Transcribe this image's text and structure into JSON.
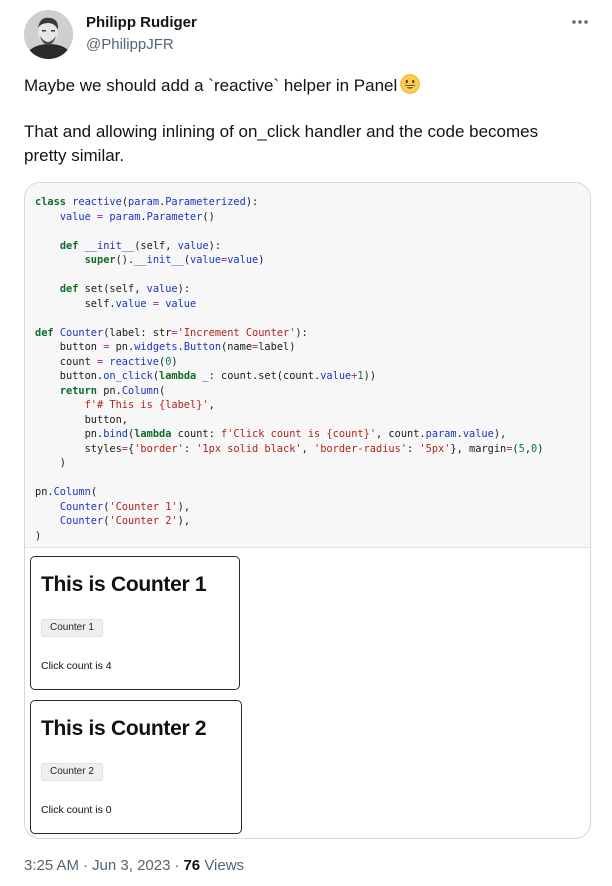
{
  "author": {
    "name": "Philipp Rudiger",
    "handle": "@PhilippJFR"
  },
  "tweet": {
    "line1": "Maybe we should add a `reactive` helper in Panel",
    "line1_emoji": "grinning-face-emoji",
    "line2": "That and allowing inlining of on_click handler and the code becomes pretty similar."
  },
  "media": {
    "code": [
      "class reactive(param.Parameterized):",
      "    value = param.Parameter()",
      "",
      "    def __init__(self, value):",
      "        super().__init__(value=value)",
      "",
      "    def set(self, value):",
      "        self.value = value",
      "",
      "def Counter(label: str='Increment Counter'):",
      "    button = pn.widgets.Button(name=label)",
      "    count = reactive(0)",
      "    button.on_click(lambda _: count.set(count.value+1))",
      "    return pn.Column(",
      "        f'# This is {label}',",
      "        button,",
      "        pn.bind(lambda count: f'Click count is {count}', count.param.value),",
      "        styles={'border': '1px solid black', 'border-radius': '5px'}, margin=(5,0)",
      "    )",
      "",
      "pn.Column(",
      "    Counter('Counter 1'),",
      "    Counter('Counter 2'),",
      ")"
    ],
    "counters": [
      {
        "title": "This is Counter 1",
        "button_label": "Counter 1",
        "count_text": "Click count is 4"
      },
      {
        "title": "This is Counter 2",
        "button_label": "Counter 2",
        "count_text": "Click count is 0"
      }
    ]
  },
  "meta": {
    "time": "3:25 AM",
    "date": "Jun 3, 2023",
    "views_count": "76",
    "views_label": "Views"
  },
  "icons": {
    "more": "more-horizontal-icon"
  },
  "colors": {
    "text": "#0f1419",
    "secondary": "#536471",
    "border": "#cfd9de"
  }
}
